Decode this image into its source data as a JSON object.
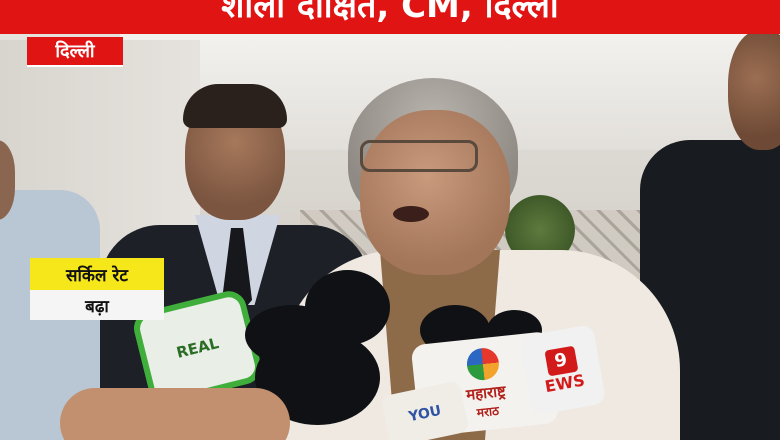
{
  "banner": {
    "text": "शीला दीक्षित, CM, दिल्ली"
  },
  "location": {
    "text": "दिल्ली"
  },
  "lower_third": {
    "line1": "सर्किल रेट",
    "line2": "बढ़ा"
  },
  "mics": {
    "green_label": "REAL",
    "center_label": "महाराष्ट्र",
    "center_label2": "मराठ",
    "right_label": "EWS",
    "right_badge": "9",
    "bottom_label": "YOU"
  },
  "colors": {
    "banner_red": "#e11414",
    "lower_third_yellow": "#f6e71a",
    "lower_third_white": "#f5f5f5"
  }
}
